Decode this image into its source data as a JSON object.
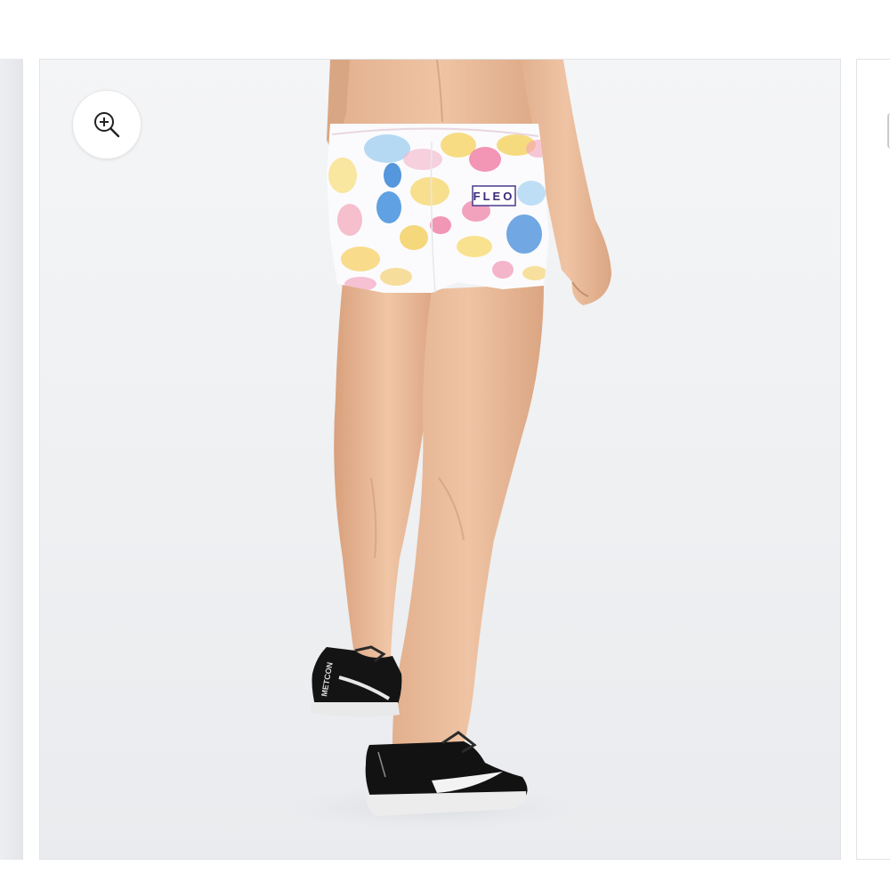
{
  "gallery": {
    "zoom_button": {
      "icon": "zoom-in-icon"
    },
    "product_image": {
      "brand_tag": "FLEO",
      "shoe_text": "METCON"
    }
  },
  "colors": {
    "background": "#ffffff",
    "image_backdrop": "#eef0f2",
    "brand_tag_text": "#3b2a7a"
  }
}
